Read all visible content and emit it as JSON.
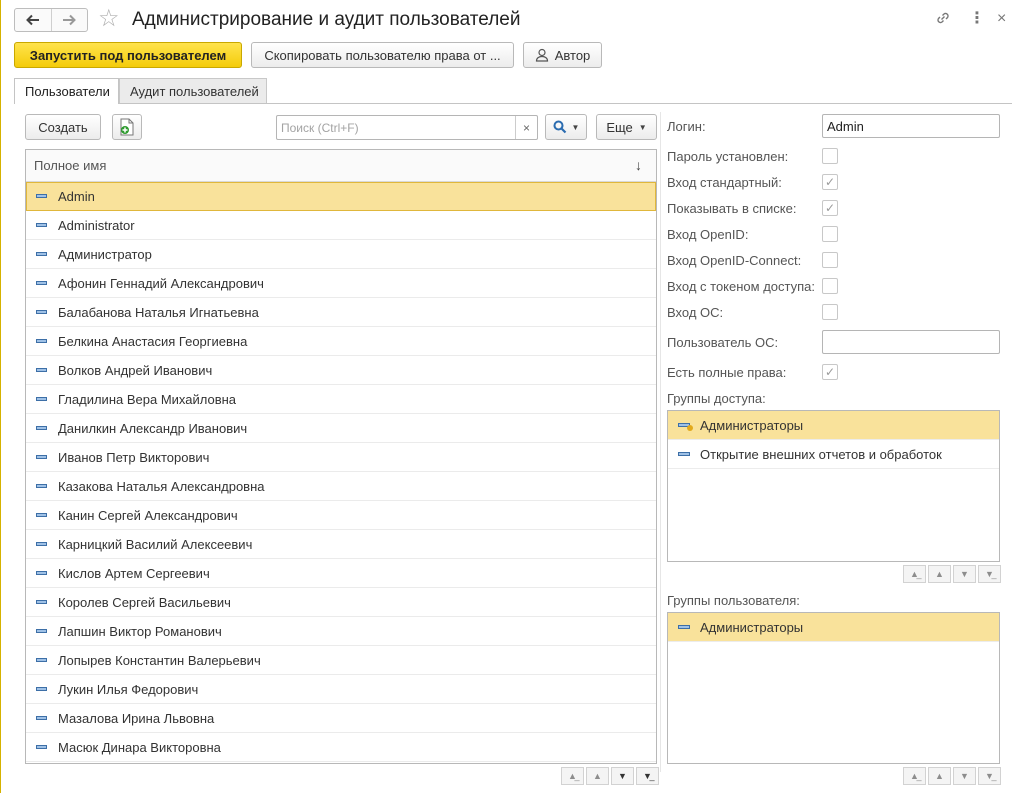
{
  "window": {
    "title": "Администрирование и аудит пользователей",
    "back_icon": "arrow-left-icon",
    "forward_icon": "arrow-right-icon",
    "star_glyph": "☆",
    "link_glyph": "🔗",
    "more_glyph": "⋮",
    "close_glyph": "×"
  },
  "toolbar": {
    "run_as_user": "Запустить под пользователем",
    "copy_rights": "Скопировать пользователю права от ...",
    "author": "Автор"
  },
  "tabs": [
    {
      "label": "Пользователи",
      "active": true
    },
    {
      "label": "Аудит пользователей",
      "active": false
    }
  ],
  "list": {
    "create_label": "Создать",
    "search_placeholder": "Поиск (Ctrl+F)",
    "search_clear_glyph": "×",
    "more_label": "Еще",
    "column_header": "Полное имя",
    "sort_glyph": "↓",
    "rows": [
      "Admin",
      "Administrator",
      "Администратор",
      "Афонин Геннадий Александрович",
      "Балабанова Наталья Игнатьевна",
      "Белкина Анастасия Георгиевна",
      "Волков Андрей Иванович",
      "Гладилина Вера Михайловна",
      "Данилкин Александр Иванович",
      "Иванов Петр Викторович",
      "Казакова Наталья Александровна",
      "Канин Сергей Александрович",
      "Карницкий Василий Алексеевич",
      "Кислов Артем Сергеевич",
      "Королев Сергей Васильевич",
      "Лапшин Виктор Романович",
      "Лопырев Константин Валерьевич",
      "Лукин Илья Федорович",
      "Мазалова Ирина Львовна",
      "Масюк Динара Викторовна"
    ],
    "selected_index": 0
  },
  "details": {
    "login_label": "Логин:",
    "login_value": "Admin",
    "password_set_label": "Пароль установлен:",
    "password_set": false,
    "standard_login_label": "Вход стандартный:",
    "standard_login": true,
    "show_in_list_label": "Показывать в списке:",
    "show_in_list": true,
    "openid_label": "Вход OpenID:",
    "openid": false,
    "openid_connect_label": "Вход OpenID-Connect:",
    "openid_connect": false,
    "token_label": "Вход с токеном доступа:",
    "token": false,
    "os_login_label": "Вход ОС:",
    "os_login": false,
    "os_user_label": "Пользователь ОС:",
    "os_user_value": "",
    "full_rights_label": "Есть полные права:",
    "full_rights": true,
    "access_groups_label": "Группы доступа:",
    "access_groups": [
      "Администраторы",
      "Открытие внешних отчетов и обработок"
    ],
    "user_groups_label": "Группы пользователя:",
    "user_groups": [
      "Администраторы"
    ]
  },
  "colors": {
    "accent_yellow": "#f4cc0a",
    "selected_row": "#f9e29b",
    "row_icon_blue": "#3d6fa7"
  }
}
